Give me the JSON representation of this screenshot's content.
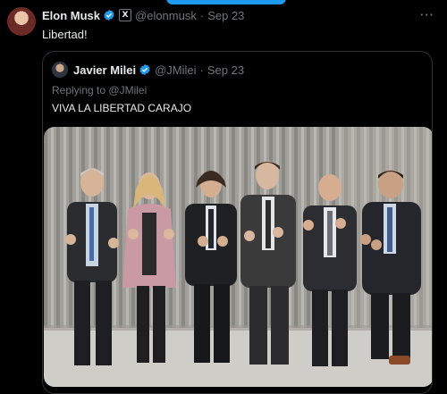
{
  "post": {
    "author_name": "Elon Musk",
    "author_handle": "@elonmusk",
    "date": "Sep 23",
    "separator": "·",
    "more_icon": "more-icon",
    "text": "Libertad!"
  },
  "quoted_post": {
    "author_name": "Javier Milei",
    "author_handle": "@JMilei",
    "date": "Sep 23",
    "separator": "·",
    "replying_prefix": "Replying to",
    "replying_to": "@JMilei",
    "text": "VIVA LA LIBERTAD CARAJO"
  },
  "colors": {
    "background": "#000000",
    "accent": "#1d9bf0",
    "secondary_text": "#71767b",
    "border": "#2f3336"
  }
}
